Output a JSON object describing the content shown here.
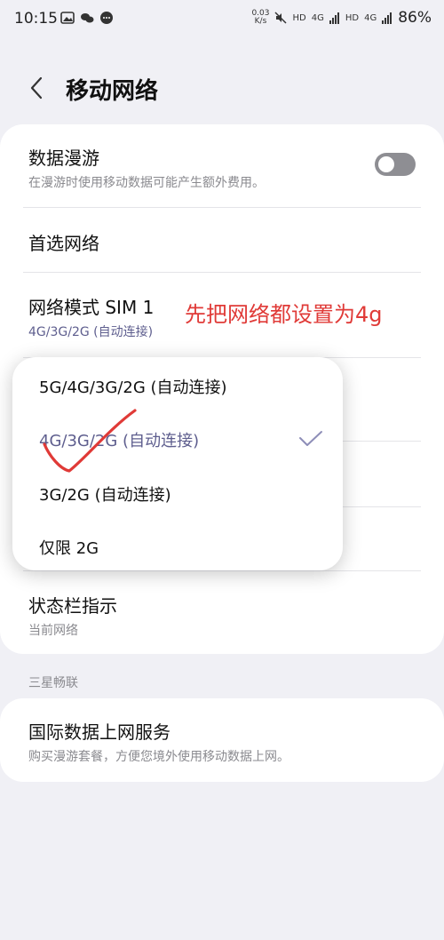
{
  "status_bar": {
    "time": "10:15",
    "speed_value": "0.03",
    "speed_unit": "K/s",
    "hd1": "HD",
    "net1": "4G",
    "hd2": "HD",
    "net2": "4G",
    "battery": "86%"
  },
  "header": {
    "title": "移动网络"
  },
  "settings": {
    "roaming_title": "数据漫游",
    "roaming_sub": "在漫游时使用移动数据可能产生额外费用。",
    "preferred_network": "首选网络",
    "network_mode_title": "网络模式 SIM 1",
    "network_mode_value": "4G/3G/2G (自动连接)",
    "status_bar_title": "状态栏指示",
    "status_bar_sub": "当前网络"
  },
  "annotation": "先把网络都设置为4g",
  "section_header": "三星畅联",
  "intl": {
    "title": "国际数据上网服务",
    "sub": "购买漫游套餐，方便您境外使用移动数据上网。"
  },
  "dropdown": {
    "options": [
      "5G/4G/3G/2G (自动连接)",
      "4G/3G/2G (自动连接)",
      "3G/2G (自动连接)",
      "仅限 2G"
    ]
  },
  "colors": {
    "annotation": "#e03a37",
    "selected": "#5e5e8e",
    "toggle_off": "#8e8e93"
  }
}
